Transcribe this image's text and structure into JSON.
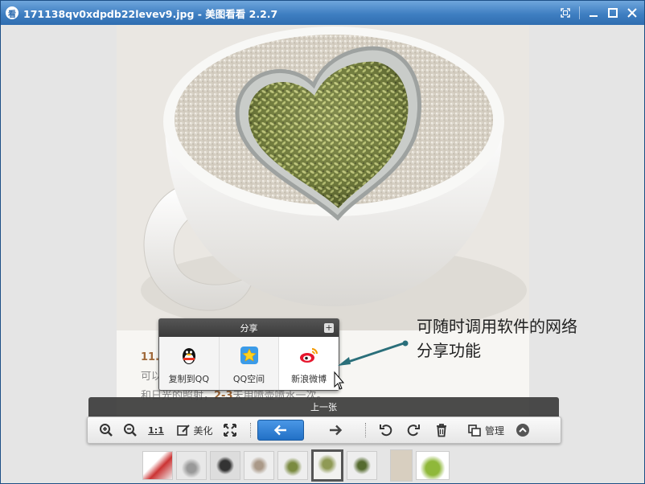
{
  "window": {
    "title": "171138qv0xdpdb22levev9.jpg - 美图看看 2.2.7",
    "app_icon_glyph": "看"
  },
  "page_text": {
    "line1_num": "11.",
    "line2": "可以",
    "line3_a": "和日光的照射，",
    "line3_b": "2-3",
    "line3_c": "天用喷壶喷水一次。"
  },
  "share_panel": {
    "title": "分享",
    "plus": "+",
    "items": [
      {
        "label": "复制到QQ",
        "icon": "qq-penguin-icon"
      },
      {
        "label": "QQ空间",
        "icon": "qzone-star-icon"
      },
      {
        "label": "新浪微博",
        "icon": "weibo-icon"
      }
    ]
  },
  "annotation": {
    "line1": "可随时调用软件的网络",
    "line2": "分享功能"
  },
  "prev_bar": {
    "label": "上一张"
  },
  "toolbar": {
    "actual_size": "1:1",
    "beautify": "美化",
    "manage": "管理"
  },
  "colors": {
    "titlebar": "#3f7fc2",
    "nav_button": "#2a7ad0",
    "arrow_annotation": "#2a6f7a"
  }
}
